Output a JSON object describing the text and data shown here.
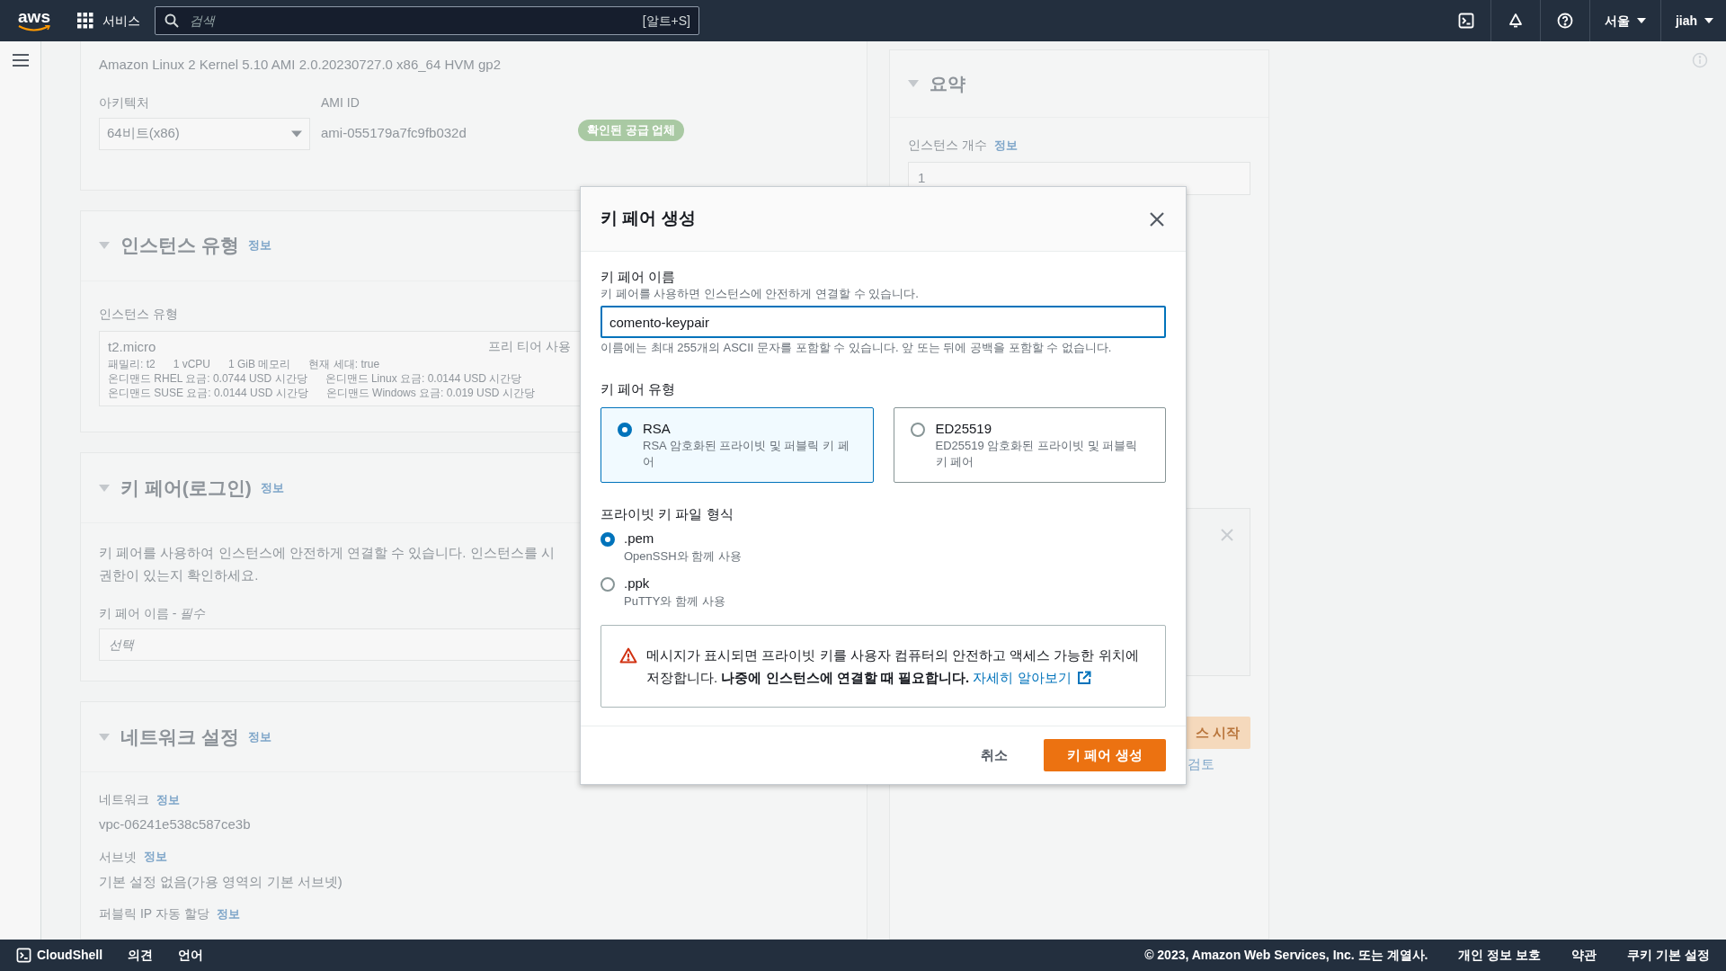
{
  "top_nav": {
    "logo": "aws",
    "services": "서비스",
    "search": {
      "placeholder": "검색",
      "shortcut": "[알트+S]"
    },
    "region": "서울",
    "user": "jiah"
  },
  "ami": {
    "name": "Amazon Linux 2 Kernel 5.10 AMI 2.0.20230727.0 x86_64 HVM gp2",
    "architecture_label": "아키텍처",
    "architecture": "64비트(x86)",
    "ami_id_label": "AMI ID",
    "ami_id": "ami-055179a7fc9fb032d",
    "badge": "확인된 공급 업체"
  },
  "instance_type": {
    "title": "인스턴스 유형",
    "info": "정보",
    "field_label": "인스턴스 유형",
    "type": "t2.micro",
    "free_tier": "프리 티어 사용",
    "specs": [
      "패밀리: t2",
      "1 vCPU",
      "1 GiB 메모리",
      "현재 세대: true"
    ],
    "prices": [
      [
        "온디맨드 RHEL 요금: 0.0744 USD 시간당",
        "온디맨드 Linux 요금: 0.0144 USD 시간당"
      ],
      [
        "온디맨드 SUSE 요금: 0.0144 USD 시간당",
        "온디맨드 Windows 요금: 0.019 USD 시간당"
      ]
    ]
  },
  "key_pair": {
    "title": "키 페어(로그인)",
    "info": "정보",
    "description": [
      "키 페어를 사용하여 인스턴스에 안전하게 연결할 수 있습니다. 인스턴스를 시",
      "권한이 있는지 확인하세요."
    ],
    "field_label": "키 페어 이름 - *필수*",
    "placeholder": "선택"
  },
  "network": {
    "title": "네트워크 설정",
    "info": "정보",
    "fields": [
      {
        "label": "네트워크",
        "info": "정보",
        "value": "vpc-06241e538c587ce3b"
      },
      {
        "label": "서브넷",
        "info": "정보",
        "value": "기본 설정 없음(가용 영역의 기본 서브넷)"
      },
      {
        "label": "퍼블릭 IP 자동 할당",
        "info": "정보"
      }
    ]
  },
  "summary": {
    "title": "요약",
    "count_label": "인스턴스 개수",
    "info": "정보",
    "count": "1",
    "launch_button": "스 시작",
    "review_link": "검토"
  },
  "modal": {
    "title": "키 페어 생성",
    "name_label": "키 페어 이름",
    "name_description": "키 페어를 사용하면 인스턴스에 안전하게 연결할 수 있습니다.",
    "name_value": "comento-keypair",
    "name_constraint": "이름에는 최대 255개의 ASCII 문자를 포함할 수 있습니다. 앞 또는 뒤에 공백을 포함할 수 없습니다.",
    "type_label": "키 페어 유형",
    "key_types": [
      {
        "label": "RSA",
        "description": "RSA 암호화된 프라이빗 및 퍼블릭 키 페어",
        "selected": true
      },
      {
        "label": "ED25519",
        "description": "ED25519 암호화된 프라이빗 및 퍼블릭 키 페어",
        "selected": false
      }
    ],
    "format_label": "프라이빗 키 파일 형식",
    "formats": [
      {
        "label": ".pem",
        "description": "OpenSSH와 함께 사용",
        "selected": true
      },
      {
        "label": ".ppk",
        "description": "PuTTY와 함께 사용",
        "selected": false
      }
    ],
    "alert": {
      "text": "메시지가 표시되면 프라이빗 키를 사용자 컴퓨터의 안전하고 액세스 가능한 위치에 저장합니다. **나중에 인스턴스에 연결할 때 필요합니다.**",
      "link": "자세히 알아보기"
    },
    "cancel": "취소",
    "submit": "키 페어 생성"
  },
  "footer": {
    "cloudshell": "CloudShell",
    "feedback": "의견",
    "language": "언어",
    "copyright": "© 2023, Amazon Web Services, Inc. 또는 계열사.",
    "links": [
      "개인 정보 보호",
      "약관",
      "쿠키 기본 설정"
    ]
  }
}
